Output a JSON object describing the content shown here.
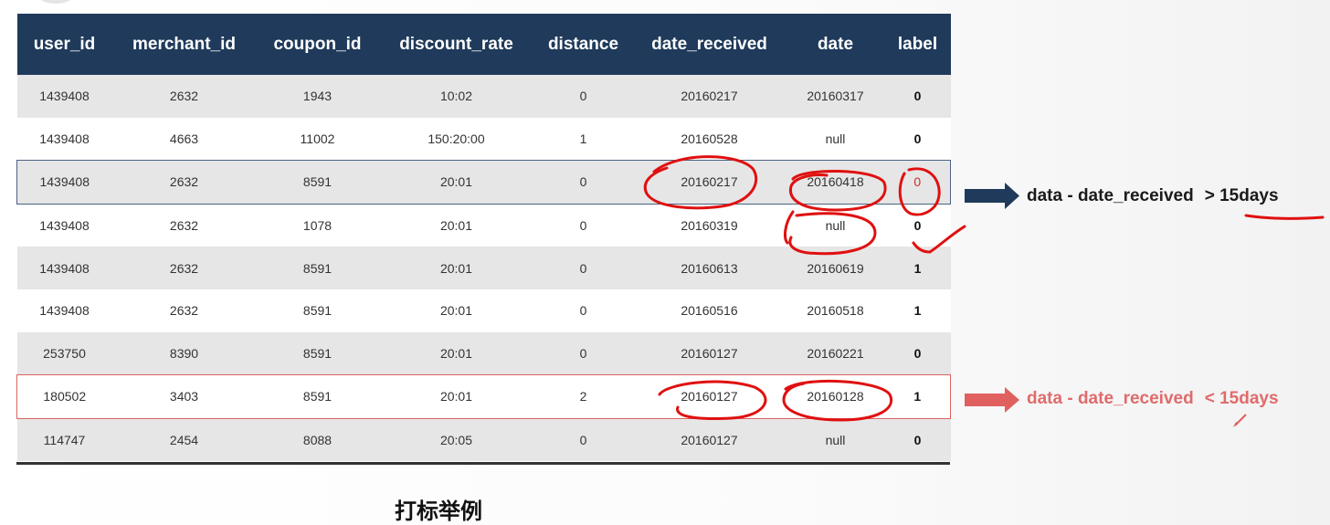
{
  "table": {
    "headers": [
      "user_id",
      "merchant_id",
      "coupon_id",
      "discount_rate",
      "distance",
      "date_received",
      "date",
      "label"
    ],
    "rows": [
      [
        "1439408",
        "2632",
        "1943",
        "10:02",
        "0",
        "20160217",
        "20160317",
        "0"
      ],
      [
        "1439408",
        "4663",
        "11002",
        "150:20:00",
        "1",
        "20160528",
        "null",
        "0"
      ],
      [
        "1439408",
        "2632",
        "8591",
        "20:01",
        "0",
        "20160217",
        "20160418",
        "0"
      ],
      [
        "1439408",
        "2632",
        "1078",
        "20:01",
        "0",
        "20160319",
        "null",
        "0"
      ],
      [
        "1439408",
        "2632",
        "8591",
        "20:01",
        "0",
        "20160613",
        "20160619",
        "1"
      ],
      [
        "1439408",
        "2632",
        "8591",
        "20:01",
        "0",
        "20160516",
        "20160518",
        "1"
      ],
      [
        "253750",
        "8390",
        "8591",
        "20:01",
        "0",
        "20160127",
        "20160221",
        "0"
      ],
      [
        "180502",
        "3403",
        "8591",
        "20:01",
        "2",
        "20160127",
        "20160128",
        "1"
      ],
      [
        "114747",
        "2454",
        "8088",
        "20:05",
        "0",
        "20160127",
        "null",
        "0"
      ]
    ]
  },
  "annotations": {
    "gt": {
      "text": "data - date_received",
      "comparison": "> 15days"
    },
    "lt": {
      "text": "data - date_received",
      "comparison": "< 15days"
    }
  },
  "caption": "打标举例",
  "colors": {
    "header_bg": "#1f3a5a",
    "row_alt_bg": "#e6e6e6",
    "highlight_blue": "#4a6281",
    "highlight_red": "#e06060",
    "pen_red": "#e01010",
    "arrow_blue": "#1f3a5a",
    "arrow_red": "#e06060"
  }
}
